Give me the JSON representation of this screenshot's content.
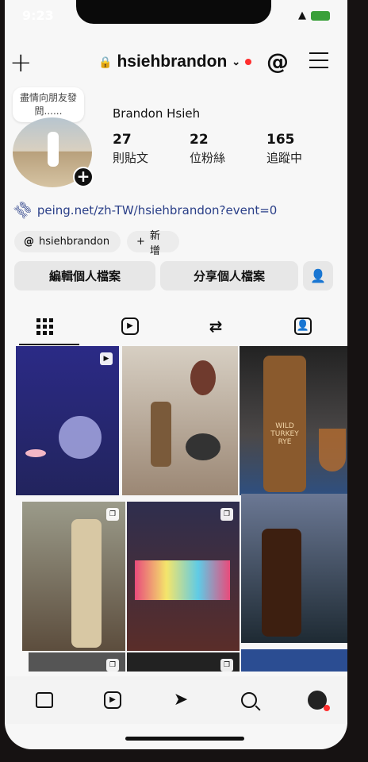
{
  "status": {
    "time": "9:23"
  },
  "profile": {
    "username": "hsiehbrandon",
    "display_name": "Brandon Hsieh",
    "note": "盡情向朋友發問......",
    "stats": [
      {
        "value": "27",
        "label": "則貼文"
      },
      {
        "value": "22",
        "label": "位粉絲"
      },
      {
        "value": "165",
        "label": "追蹤中"
      }
    ],
    "link": "peing.net/zh-TW/hsiehbrandon?event=0",
    "chips": {
      "threads": "hsiehbrandon",
      "add": "新增"
    },
    "buttons": {
      "edit": "編輯個人檔案",
      "share": "分享個人檔案"
    }
  },
  "icons": {
    "create": "plus-icon",
    "threads": "threads-icon",
    "menu": "menu-icon",
    "link": "link-icon",
    "tabs": [
      "grid-icon",
      "reels-icon",
      "reposts-icon",
      "tagged-icon"
    ],
    "bottom": [
      "home-icon",
      "reels-icon",
      "send-icon",
      "search-icon",
      "profile-icon"
    ]
  },
  "colors": {
    "notification_dot": "#ff2e2e",
    "link": "#2a3f88",
    "battery": "#3aa03a"
  },
  "wild_turkey_label": "WILD TURKEY RYE"
}
